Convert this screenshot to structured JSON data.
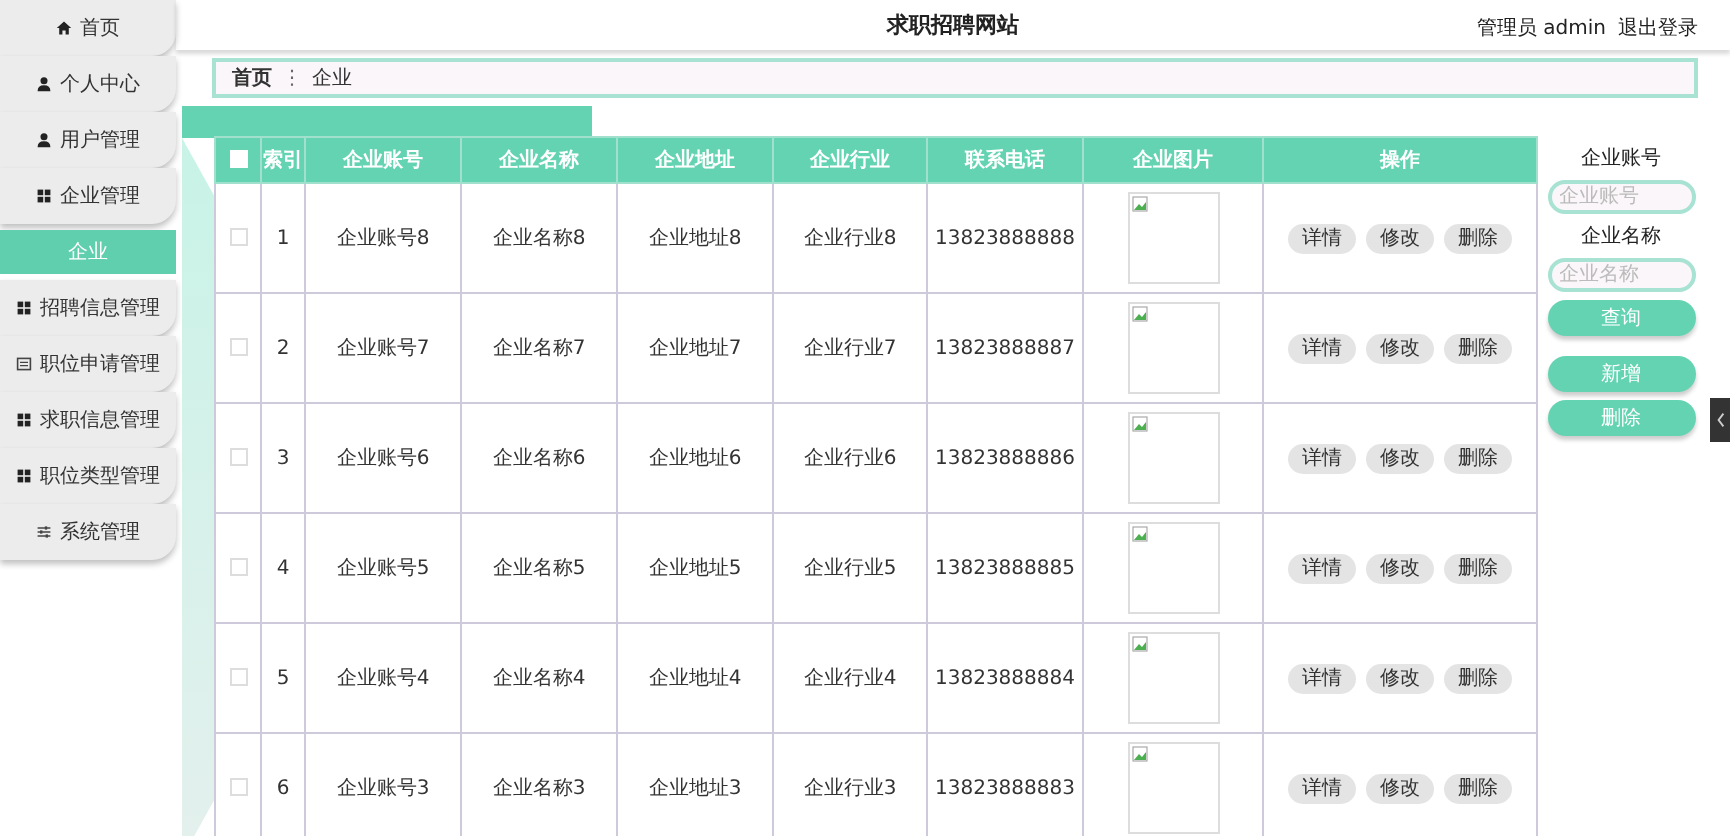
{
  "header": {
    "title": "求职招聘网站",
    "user": "管理员 admin",
    "logout": "退出登录"
  },
  "sidebar": {
    "items": [
      {
        "label": "首页",
        "kind": "menu",
        "selected": false
      },
      {
        "label": "个人中心",
        "kind": "menu",
        "selected": false
      },
      {
        "label": "用户管理",
        "kind": "menu",
        "selected": false
      },
      {
        "label": "企业管理",
        "kind": "menu",
        "selected": false
      },
      {
        "label": "企业",
        "kind": "sub",
        "selected": true
      },
      {
        "label": "招聘信息管理",
        "kind": "menu",
        "selected": false
      },
      {
        "label": "职位申请管理",
        "kind": "menu",
        "selected": false
      },
      {
        "label": "求职信息管理",
        "kind": "menu",
        "selected": false
      },
      {
        "label": "职位类型管理",
        "kind": "menu",
        "selected": false
      },
      {
        "label": "系统管理",
        "kind": "menu",
        "selected": false
      }
    ]
  },
  "breadcrumb": {
    "home": "首页",
    "separator": "⋮",
    "current": "企业"
  },
  "table": {
    "select_all": {
      "checked": false
    },
    "columns": [
      "索引",
      "企业账号",
      "企业名称",
      "企业地址",
      "企业行业",
      "联系电话",
      "企业图片",
      "操作"
    ],
    "rows": [
      {
        "checked": false,
        "index": "1",
        "account": "企业账号8",
        "name": "企业名称8",
        "address": "企业地址8",
        "industry": "企业行业8",
        "phone": "13823888888",
        "actions": [
          "详情",
          "修改",
          "删除"
        ]
      },
      {
        "checked": false,
        "index": "2",
        "account": "企业账号7",
        "name": "企业名称7",
        "address": "企业地址7",
        "industry": "企业行业7",
        "phone": "13823888887",
        "actions": [
          "详情",
          "修改",
          "删除"
        ]
      },
      {
        "checked": false,
        "index": "3",
        "account": "企业账号6",
        "name": "企业名称6",
        "address": "企业地址6",
        "industry": "企业行业6",
        "phone": "13823888886",
        "actions": [
          "详情",
          "修改",
          "删除"
        ]
      },
      {
        "checked": false,
        "index": "4",
        "account": "企业账号5",
        "name": "企业名称5",
        "address": "企业地址5",
        "industry": "企业行业5",
        "phone": "13823888885",
        "actions": [
          "详情",
          "修改",
          "删除"
        ]
      },
      {
        "checked": false,
        "index": "5",
        "account": "企业账号4",
        "name": "企业名称4",
        "address": "企业地址4",
        "industry": "企业行业4",
        "phone": "13823888884",
        "actions": [
          "详情",
          "修改",
          "删除"
        ]
      },
      {
        "checked": false,
        "index": "6",
        "account": "企业账号3",
        "name": "企业名称3",
        "address": "企业地址3",
        "industry": "企业行业3",
        "phone": "13823888883",
        "actions": [
          "详情",
          "修改",
          "删除"
        ]
      }
    ]
  },
  "search": {
    "fields": [
      {
        "label": "企业账号",
        "placeholder": "企业账号"
      },
      {
        "label": "企业名称",
        "placeholder": "企业名称"
      }
    ],
    "query_button": "查询",
    "add_button": "新增",
    "delete_button": "删除"
  }
}
